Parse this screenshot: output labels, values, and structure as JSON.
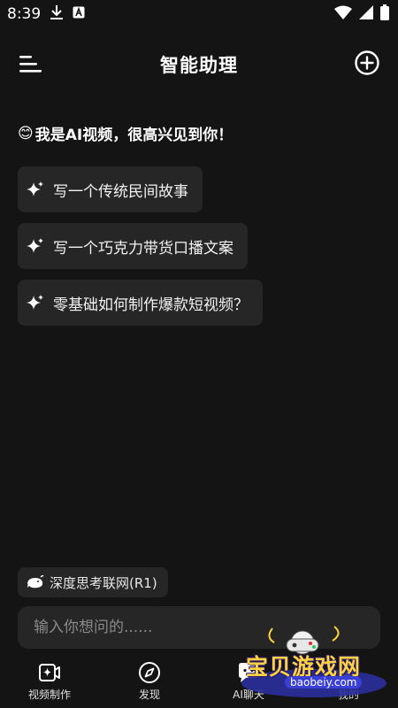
{
  "status_bar": {
    "time": "8:39"
  },
  "header": {
    "title": "智能助理"
  },
  "greeting": {
    "emoji": "😊",
    "text": "我是AI视频，很高兴见到你！"
  },
  "suggestions": [
    {
      "label": "写一个传统民间故事"
    },
    {
      "label": "写一个巧克力带货口播文案"
    },
    {
      "label": "零基础如何制作爆款短视频？"
    }
  ],
  "deep_think": {
    "label": "深度思考联网(R1)"
  },
  "input": {
    "placeholder": "输入你想问的......"
  },
  "nav": {
    "items": [
      {
        "label": "视频制作",
        "icon": "video-create-icon"
      },
      {
        "label": "发现",
        "icon": "compass-icon"
      },
      {
        "label": "AI聊天",
        "icon": "chat-icon"
      },
      {
        "label": "我的",
        "icon": "profile-icon"
      }
    ]
  },
  "watermark": {
    "text": "宝贝游戏网",
    "url": "baobeiy.com"
  },
  "colors": {
    "background": "#141414",
    "card": "#262626",
    "accent": "#ffd23f"
  }
}
